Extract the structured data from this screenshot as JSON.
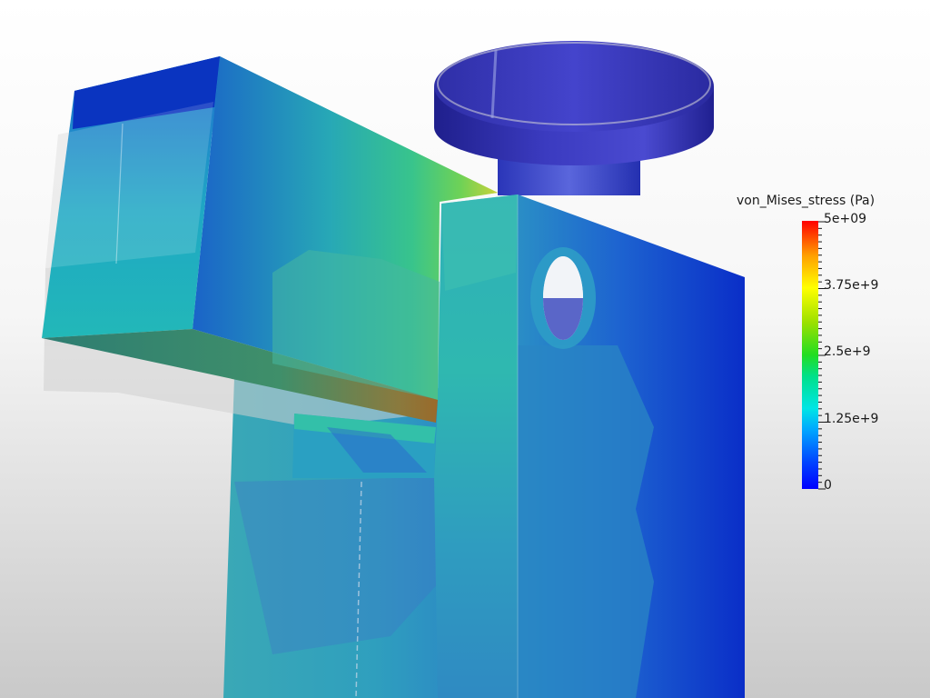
{
  "legend": {
    "title": "von_Mises_stress (Pa)",
    "labels": [
      "5e+09",
      "3.75e+9",
      "2.5e+9",
      "1.25e+9",
      "0"
    ],
    "min": 0,
    "max": 5000000000,
    "colors": [
      "#0000ff",
      "#00a6ff",
      "#00e5e5",
      "#22dd22",
      "#ffff00",
      "#ffa000",
      "#ff0000"
    ]
  }
}
